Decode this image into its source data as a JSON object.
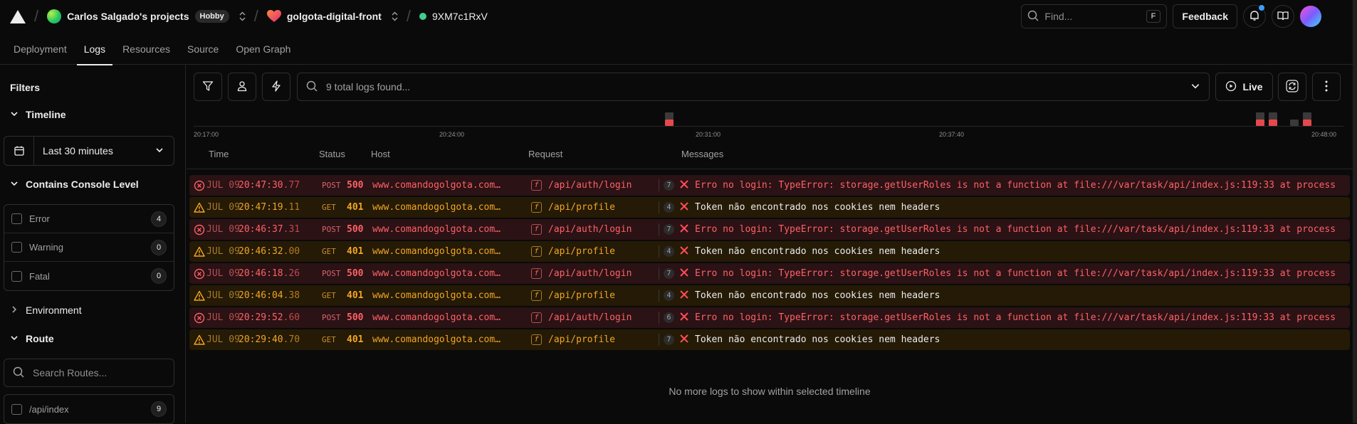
{
  "topbar": {
    "team": "Carlos Salgado's projects",
    "plan_badge": "Hobby",
    "project": "golgota-digital-front",
    "deployment_id": "9XM7c1RxV",
    "find_placeholder": "Find...",
    "find_shortcut": "F",
    "feedback_label": "Feedback"
  },
  "tabs": [
    {
      "label": "Deployment"
    },
    {
      "label": "Logs"
    },
    {
      "label": "Resources"
    },
    {
      "label": "Source"
    },
    {
      "label": "Open Graph"
    }
  ],
  "active_tab": "Logs",
  "sidebar": {
    "title": "Filters",
    "timeline_label": "Timeline",
    "timeline_value": "Last 30 minutes",
    "console_level_label": "Contains Console Level",
    "levels": [
      {
        "label": "Error",
        "count": "4"
      },
      {
        "label": "Warning",
        "count": "0"
      },
      {
        "label": "Fatal",
        "count": "0"
      }
    ],
    "environment_label": "Environment",
    "route_label": "Route",
    "route_search_placeholder": "Search Routes...",
    "routes": [
      {
        "label": "/api/index",
        "count": "9"
      }
    ]
  },
  "main": {
    "search_placeholder": "9 total logs found...",
    "live_label": "Live",
    "timeline_ticks": [
      "20:17:00",
      "20:24:00",
      "20:31:00",
      "20:37:40",
      "20:48:00"
    ],
    "columns": {
      "time": "Time",
      "status": "Status",
      "host": "Host",
      "request": "Request",
      "messages": "Messages"
    },
    "rows": [
      {
        "level": "error",
        "date": "JUL 09",
        "time": "20:47:30",
        "ms": ".77",
        "method": "POST",
        "status": "500",
        "host": "www.comandogolgota.com...",
        "request": "/api/auth/login",
        "count": "7",
        "message": "Erro no login: TypeError: storage.getUserRoles is not a function at file:///var/task/api/index.js:119:33 at process"
      },
      {
        "level": "warning",
        "date": "JUL 09",
        "time": "20:47:19",
        "ms": ".11",
        "method": "GET",
        "status": "401",
        "host": "www.comandogolgota.com...",
        "request": "/api/profile",
        "count": "4",
        "message": "Token não encontrado nos cookies nem headers"
      },
      {
        "level": "error",
        "date": "JUL 09",
        "time": "20:46:37",
        "ms": ".31",
        "method": "POST",
        "status": "500",
        "host": "www.comandogolgota.com...",
        "request": "/api/auth/login",
        "count": "7",
        "message": "Erro no login: TypeError: storage.getUserRoles is not a function at file:///var/task/api/index.js:119:33 at process"
      },
      {
        "level": "warning",
        "date": "JUL 09",
        "time": "20:46:32",
        "ms": ".00",
        "method": "GET",
        "status": "401",
        "host": "www.comandogolgota.com...",
        "request": "/api/profile",
        "count": "4",
        "message": "Token não encontrado nos cookies nem headers"
      },
      {
        "level": "error",
        "date": "JUL 09",
        "time": "20:46:18",
        "ms": ".26",
        "method": "POST",
        "status": "500",
        "host": "www.comandogolgota.com...",
        "request": "/api/auth/login",
        "count": "7",
        "message": "Erro no login: TypeError: storage.getUserRoles is not a function at file:///var/task/api/index.js:119:33 at process"
      },
      {
        "level": "warning",
        "date": "JUL 09",
        "time": "20:46:04",
        "ms": ".38",
        "method": "GET",
        "status": "401",
        "host": "www.comandogolgota.com...",
        "request": "/api/profile",
        "count": "4",
        "message": "Token não encontrado nos cookies nem headers"
      },
      {
        "level": "error",
        "date": "JUL 09",
        "time": "20:29:52",
        "ms": ".60",
        "method": "POST",
        "status": "500",
        "host": "www.comandogolgota.com...",
        "request": "/api/auth/login",
        "count": "6",
        "message": "Erro no login: TypeError: storage.getUserRoles is not a function at file:///var/task/api/index.js:119:33 at process"
      },
      {
        "level": "warning",
        "date": "JUL 09",
        "time": "20:29:40",
        "ms": ".70",
        "method": "GET",
        "status": "401",
        "host": "www.comandogolgota.com...",
        "request": "/api/profile",
        "count": "7",
        "message": "Token não encontrado nos cookies nem headers"
      }
    ],
    "no_more_text": "No more logs to show within selected timeline"
  },
  "colors": {
    "error": "#ff6166",
    "warning": "#f2a524",
    "error_row_bg": "#2a1215",
    "warning_row_bg": "#241a06",
    "bar_red": "#e5484d",
    "bar_gray": "#3a3a3a"
  }
}
